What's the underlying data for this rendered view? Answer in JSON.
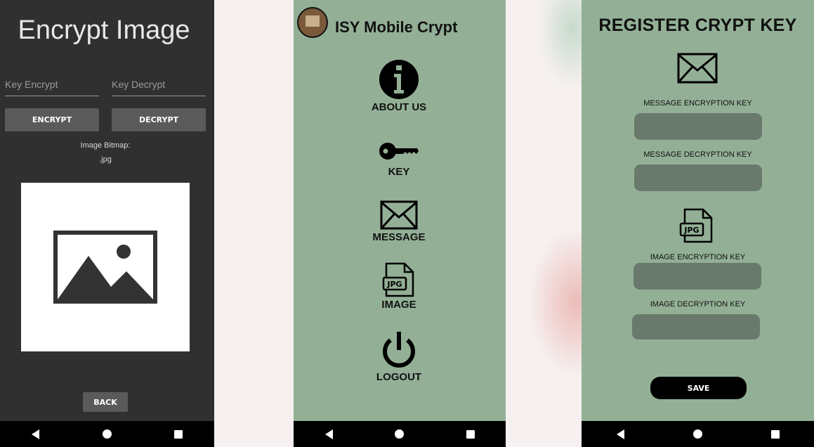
{
  "screen_encrypt": {
    "title": "Encrypt Image",
    "key_encrypt_placeholder": "Key Encrypt",
    "key_decrypt_placeholder": "Key Decrypt",
    "encrypt_label": "ENCRYPT",
    "decrypt_label": "DECRYPT",
    "bitmap_label": "Image Bitmap:",
    "extension": ".jpg",
    "back_label": "BACK",
    "image_icon": "image-placeholder-icon"
  },
  "screen_menu": {
    "app_title": "ISY Mobile Crypt",
    "items": [
      {
        "label": "ABOUT US",
        "icon": "info-icon"
      },
      {
        "label": "KEY",
        "icon": "key-icon"
      },
      {
        "label": "MESSAGE",
        "icon": "envelope-icon"
      },
      {
        "label": "IMAGE",
        "icon": "jpg-file-icon"
      },
      {
        "label": "LOGOUT",
        "icon": "power-icon"
      }
    ]
  },
  "screen_register": {
    "title": "REGISTER CRYPT KEY",
    "fields": [
      {
        "label": "MESSAGE ENCRYPTION KEY",
        "value": ""
      },
      {
        "label": "MESSAGE DECRYPTION KEY",
        "value": ""
      },
      {
        "label": "IMAGE ENCRYPTION KEY",
        "value": ""
      },
      {
        "label": "IMAGE DECRYPTION KEY",
        "value": ""
      }
    ],
    "save_label": "SAVE"
  },
  "nav": {
    "back_icon": "nav-back-icon",
    "home_icon": "nav-home-icon",
    "recents_icon": "nav-recents-icon"
  },
  "colors": {
    "dark_bg": "#303030",
    "green_bg": "#93b096",
    "field_fill": "#697a6d",
    "button_gray": "#5a5a5a"
  }
}
